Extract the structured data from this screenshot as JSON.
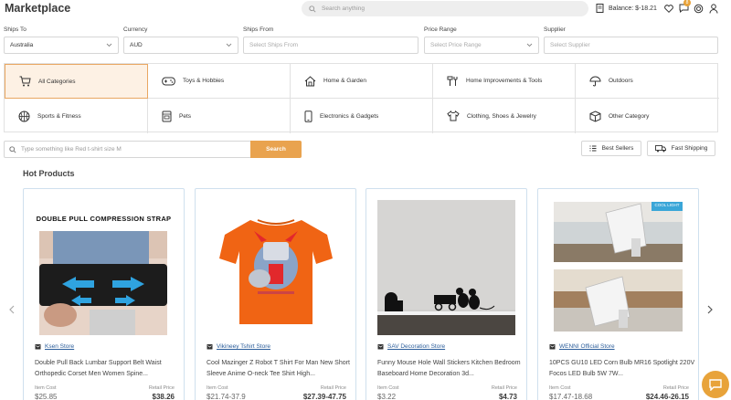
{
  "header": {
    "title": "Marketplace",
    "search_placeholder": "Search anything",
    "balance": "Balance: $-18.21",
    "notification_count": "8"
  },
  "filters": [
    {
      "label": "Ships To",
      "value": "Australia",
      "placeholder": false
    },
    {
      "label": "Currency",
      "value": "AUD",
      "placeholder": false
    },
    {
      "label": "Ships From",
      "value": "Select Ships From",
      "placeholder": true
    },
    {
      "label": "Price Range",
      "value": "Select Price Range",
      "placeholder": true
    },
    {
      "label": "Supplier",
      "value": "Select Supplier",
      "placeholder": true
    }
  ],
  "categories": [
    {
      "label": "All Categories",
      "icon": "cart-icon",
      "active": true
    },
    {
      "label": "Toys & Hobbies",
      "icon": "gamepad-icon",
      "active": false
    },
    {
      "label": "Home & Garden",
      "icon": "house-icon",
      "active": false
    },
    {
      "label": "Home Improvements & Tools",
      "icon": "tools-icon",
      "active": false
    },
    {
      "label": "Outdoors",
      "icon": "umbrella-icon",
      "active": false
    },
    {
      "label": "Sports & Fitness",
      "icon": "basketball-icon",
      "active": false
    },
    {
      "label": "Pets",
      "icon": "pet-food-icon",
      "active": false
    },
    {
      "label": "Electronics & Gadgets",
      "icon": "phone-icon",
      "active": false
    },
    {
      "label": "Clothing, Shoes & Jewelry",
      "icon": "shirt-icon",
      "active": false
    },
    {
      "label": "Other Category",
      "icon": "box-icon",
      "active": false
    }
  ],
  "product_search": {
    "placeholder": "Type something like Red t-shirt size M",
    "button": "Search",
    "best_sellers": "Best Sellers",
    "fast_shipping": "Fast Shipping"
  },
  "hot_products": {
    "title": "Hot Products",
    "item_cost_label": "Item Cost",
    "retail_price_label": "Retail Price",
    "items": [
      {
        "store": "Ksen Store",
        "name": "Double Pull Back Lumbar Support Belt Waist Orthopedic Corset Men Women Spine...",
        "item_cost": "$25.85",
        "retail_price": "$38.26",
        "image_caption": "DOUBLE PULL COMPRESSION STRAP"
      },
      {
        "store": "Vikineey Tshirt Store",
        "name": "Cool Mazinger Z Robot T Shirt For Man New Short Sleeve Anime O-neck Tee Shirt High...",
        "item_cost": "$21.74-37.9",
        "retail_price": "$27.39-47.75"
      },
      {
        "store": "SAV Decoration Store",
        "name": "Funny Mouse Hole Wall Stickers Kitchen Bedroom Baseboard Home Decoration 3d...",
        "item_cost": "$3.22",
        "retail_price": "$4.73"
      },
      {
        "store": "WENNI Official Store",
        "name": "10PCS GU10 LED Corn Bulb MR16 Spotlight 220V Focos LED Bulb 5W 7W...",
        "item_cost": "$17.47-18.68",
        "retail_price": "$24.46-26.15",
        "image_tag": "COOL LIGHT"
      }
    ]
  },
  "colors": {
    "accent": "#e9a34f",
    "active_bg": "#fdf1e4",
    "link": "#2b5d9a"
  }
}
